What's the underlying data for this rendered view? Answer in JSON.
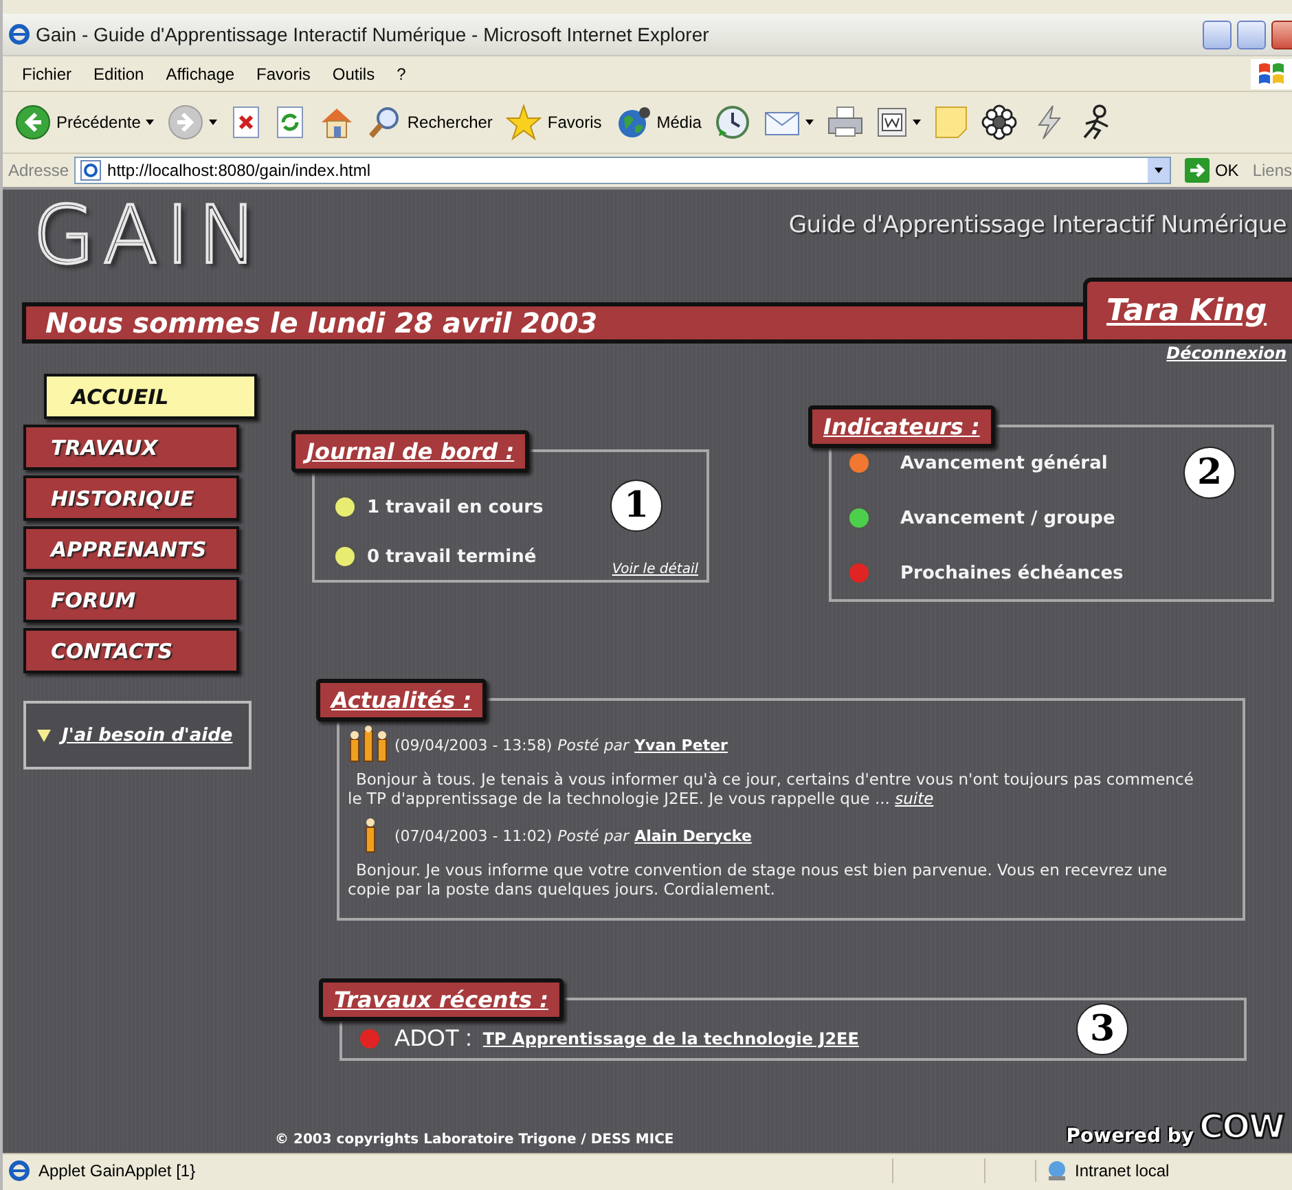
{
  "window": {
    "title": "Gain - Guide d'Apprentissage Interactif Numérique - Microsoft Internet Explorer"
  },
  "menu": [
    "Fichier",
    "Edition",
    "Affichage",
    "Favoris",
    "Outils",
    "?"
  ],
  "toolbar": [
    {
      "kind": "back",
      "label": "Précédente",
      "dropdown": true
    },
    {
      "kind": "forward",
      "dropdown": true
    },
    {
      "kind": "stop",
      "dropdown": false
    },
    {
      "kind": "refresh",
      "dropdown": false
    },
    {
      "kind": "home",
      "dropdown": false
    },
    {
      "kind": "search",
      "label": "Rechercher",
      "dropdown": false
    },
    {
      "kind": "favorites",
      "label": "Favoris",
      "dropdown": false
    },
    {
      "kind": "media",
      "label": "Média",
      "dropdown": false
    },
    {
      "kind": "history",
      "dropdown": false
    },
    {
      "kind": "mail",
      "dropdown": true
    },
    {
      "kind": "print",
      "dropdown": false
    },
    {
      "kind": "edit",
      "dropdown": true
    },
    {
      "kind": "note",
      "dropdown": false
    },
    {
      "kind": "flower",
      "dropdown": false
    },
    {
      "kind": "bolt",
      "dropdown": false
    },
    {
      "kind": "person",
      "dropdown": false
    }
  ],
  "address": {
    "label": "Adresse",
    "value": "http://localhost:8080/gain/index.html",
    "go": "OK",
    "links": "Liens"
  },
  "site": {
    "logo": "GAIN",
    "subtitle": "Guide d'Apprentissage Interactif Numérique",
    "date": "Nous sommes le lundi 28 avril 2003",
    "user": "Tara King",
    "logout": "Déconnexion"
  },
  "nav": [
    {
      "label": "ACCUEIL",
      "selected": true
    },
    {
      "label": "TRAVAUX",
      "selected": false
    },
    {
      "label": "HISTORIQUE",
      "selected": false
    },
    {
      "label": "APPRENANTS",
      "selected": false
    },
    {
      "label": "FORUM",
      "selected": false
    },
    {
      "label": "CONTACTS",
      "selected": false
    }
  ],
  "help": {
    "label": "J'ai besoin d'aide"
  },
  "journal": {
    "title": "Journal de bord :",
    "items": [
      "1 travail en cours",
      "0 travail terminé"
    ],
    "link": "Voir le détail",
    "callout": "1"
  },
  "indicators": {
    "title": "Indicateurs :",
    "callout": "2",
    "items": [
      {
        "label": "Avancement général",
        "color": "#f07830"
      },
      {
        "label": "Avancement / groupe",
        "color": "#4cd04c"
      },
      {
        "label": "Prochaines échéances",
        "color": "#e02424"
      }
    ]
  },
  "news": {
    "title": "Actualités :",
    "items": [
      {
        "kind": "group",
        "date": "(09/04/2003 - 13:58)",
        "posted_by": "Posté par",
        "author": "Yvan Peter",
        "text": "Bonjour à tous. Je tenais à vous informer qu'à ce jour, certains d'entre vous n'ont toujours pas commencé le TP d'apprentissage de la technologie J2EE. Je vous rappelle que ...",
        "more": "suite"
      },
      {
        "kind": "single",
        "date": "(07/04/2003 - 11:02)",
        "posted_by": "Posté par",
        "author": "Alain Derycke",
        "text": "Bonjour. Je vous informe que votre convention de stage nous est bien parvenue. Vous en recevrez une copie par la poste dans quelques jours. Cordialement."
      }
    ]
  },
  "recent": {
    "title": "Travaux récents :",
    "callout": "3",
    "items": [
      {
        "code": "ADOT :",
        "title": "TP Apprentissage de la technologie J2EE",
        "color": "#e02424"
      }
    ]
  },
  "footer": {
    "copyright": "© 2003 copyrights Laboratoire Trigone / DESS MICE",
    "powered": "Powered by",
    "brand": "COW"
  },
  "status_bar": {
    "text": "Applet GainApplet [1}",
    "zone": "Intranet local"
  }
}
